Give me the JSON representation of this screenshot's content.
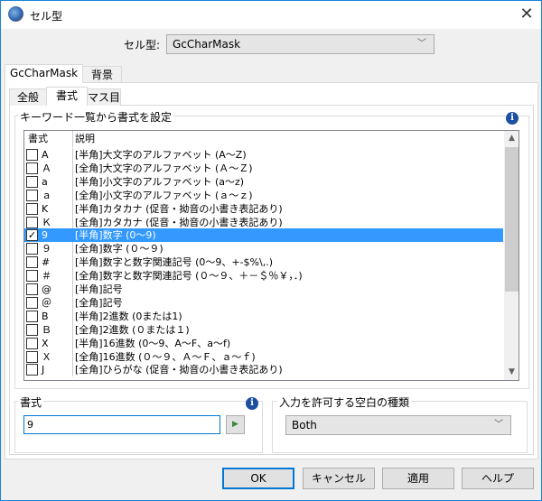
{
  "window": {
    "title": "セル型",
    "close_icon": "close-icon",
    "app_icon": "globe-icon"
  },
  "cell_type": {
    "label": "セル型:",
    "value": "GcCharMask"
  },
  "outer_tabs": [
    {
      "label": "GcCharMask",
      "selected": true
    },
    {
      "label": "背景",
      "selected": false
    }
  ],
  "inner_tabs": [
    {
      "label": "全般",
      "selected": false
    },
    {
      "label": "書式",
      "selected": true
    },
    {
      "label": "マス目",
      "selected": false
    }
  ],
  "keyword_group": {
    "title": "キーワード一覧から書式を設定",
    "columns": [
      "書式",
      "説明"
    ],
    "rows": [
      {
        "fmt": "A",
        "desc": "[半角]大文字のアルファベット (A～Z)",
        "checked": false
      },
      {
        "fmt": "Ａ",
        "desc": "[全角]大文字のアルファベット (Ａ～Ｚ)",
        "checked": false
      },
      {
        "fmt": "a",
        "desc": "[半角]小文字のアルファベット (a～z)",
        "checked": false
      },
      {
        "fmt": "ａ",
        "desc": "[全角]小文字のアルファベット (ａ～ｚ)",
        "checked": false
      },
      {
        "fmt": "K",
        "desc": "[半角]カタカナ (促音・拗音の小書き表記あり)",
        "checked": false
      },
      {
        "fmt": "Ｋ",
        "desc": "[全角]カタカナ (促音・拗音の小書き表記あり)",
        "checked": false
      },
      {
        "fmt": "9",
        "desc": "[半角]数字 (0～9)",
        "checked": true,
        "selected": true
      },
      {
        "fmt": "９",
        "desc": "[全角]数字 (０～９)",
        "checked": false
      },
      {
        "fmt": "#",
        "desc": "[半角]数字と数字関連記号 (0～9、+-$%\\,.)",
        "checked": false
      },
      {
        "fmt": "＃",
        "desc": "[全角]数字と数字関連記号 (０～９、＋－＄％￥，．)",
        "checked": false
      },
      {
        "fmt": "@",
        "desc": "[半角]記号",
        "checked": false
      },
      {
        "fmt": "＠",
        "desc": "[全角]記号",
        "checked": false
      },
      {
        "fmt": "B",
        "desc": "[半角]2進数 (0または1)",
        "checked": false
      },
      {
        "fmt": "Ｂ",
        "desc": "[全角]2進数 (０または１)",
        "checked": false
      },
      {
        "fmt": "X",
        "desc": "[半角]16進数 (0～9、A～F、a～f)",
        "checked": false
      },
      {
        "fmt": "Ｘ",
        "desc": "[全角]16進数 (０～９、Ａ～Ｆ、ａ～ｆ)",
        "checked": false
      },
      {
        "fmt": "J",
        "desc": "[全角]ひらがな (促音・拗音の小書き表記あり)",
        "checked": false
      }
    ]
  },
  "format_group": {
    "title": "書式",
    "value": "9",
    "info_icon": "info-icon"
  },
  "whitespace_group": {
    "title": "入力を許可する空白の種類",
    "value": "Both"
  },
  "buttons": {
    "ok": "OK",
    "cancel": "キャンセル",
    "apply": "適用",
    "help": "ヘルプ"
  },
  "colors": {
    "selection": "#3399ff",
    "accent": "#0078d7"
  }
}
